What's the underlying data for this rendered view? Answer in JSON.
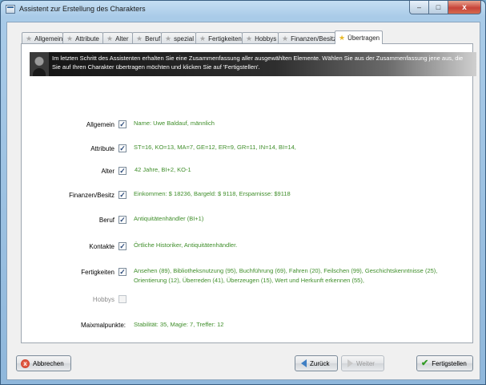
{
  "window": {
    "title": "Assistent zur Erstellung des Charakters",
    "controls": {
      "minimize": "–",
      "maximize": "□",
      "close": "x"
    }
  },
  "tabs": [
    {
      "label": "Allgemein",
      "active": false
    },
    {
      "label": "Attribute",
      "active": false
    },
    {
      "label": "Alter",
      "active": false
    },
    {
      "label": "Beruf",
      "active": false
    },
    {
      "label": "spezial",
      "active": false
    },
    {
      "label": "Fertigkeiten",
      "active": false
    },
    {
      "label": "Hobbys",
      "active": false
    },
    {
      "label": "Finanzen/Besitz",
      "active": false
    },
    {
      "label": "Übertragen",
      "active": true
    }
  ],
  "banner": {
    "text": "Im letzten Schritt des Assistenten erhalten Sie eine Zusammenfassung aller ausgewählten Elemente. Wählen Sie aus der Zusammenfassung jene aus, die Sie auf Ihren Charakter übertragen möchten und klicken Sie auf 'Fertigstellen'."
  },
  "summary": {
    "allgemein": {
      "label": "Allgemein",
      "checked": true,
      "value": "Name: Uwe Baldauf, männlich"
    },
    "attribute": {
      "label": "Attribute",
      "checked": true,
      "value": "ST=16, KO=13, MA=7, GE=12, ER=9, GR=11, IN=14, BI=14,"
    },
    "alter": {
      "label": "Alter",
      "checked": true,
      "value": "42 Jahre, BI+2, KO-1"
    },
    "finanzen": {
      "label": "Finanzen/Besitz",
      "checked": true,
      "value": "Einkommen: $ 18236, Bargeld: $ 9118, Ersparnisse: $9118"
    },
    "beruf": {
      "label": "Beruf",
      "checked": true,
      "value": "Antiquitätenhändler (BI+1)"
    },
    "kontakte": {
      "label": "Kontakte",
      "checked": true,
      "value": "Örtliche Historiker, Antiquitätenhändler."
    },
    "fertigkeiten": {
      "label": "Fertigkeiten",
      "checked": true,
      "value": "Ansehen (89), Bibliotheksnutzung (95), Buchführung (69), Fahren (20), Feilschen (99), Geschichtskenntnisse (25), Orientierung (12), Überreden (41), Überzeugen (15), Wert und Herkunft erkennen (55),"
    },
    "hobbys": {
      "label": "Hobbys",
      "checked": false,
      "value": ""
    },
    "maxpunkte": {
      "label": "Maixmalpunkte:",
      "value": "Stabilität: 35, Magie: 7, Treffer: 12"
    }
  },
  "check_mark": "✓",
  "buttons": {
    "cancel": {
      "label": "Abbrechen",
      "icon": "x"
    },
    "back": {
      "label": "Zurück"
    },
    "next": {
      "label": "Weiter",
      "enabled": false
    },
    "finish": {
      "label": "Fertigstellen"
    }
  },
  "icons": {
    "tab": "★",
    "check": "✔"
  },
  "colors": {
    "value_text": "#3f8e2a",
    "close_button": "#c7443a",
    "tab_star_active": "#e8b92a"
  }
}
